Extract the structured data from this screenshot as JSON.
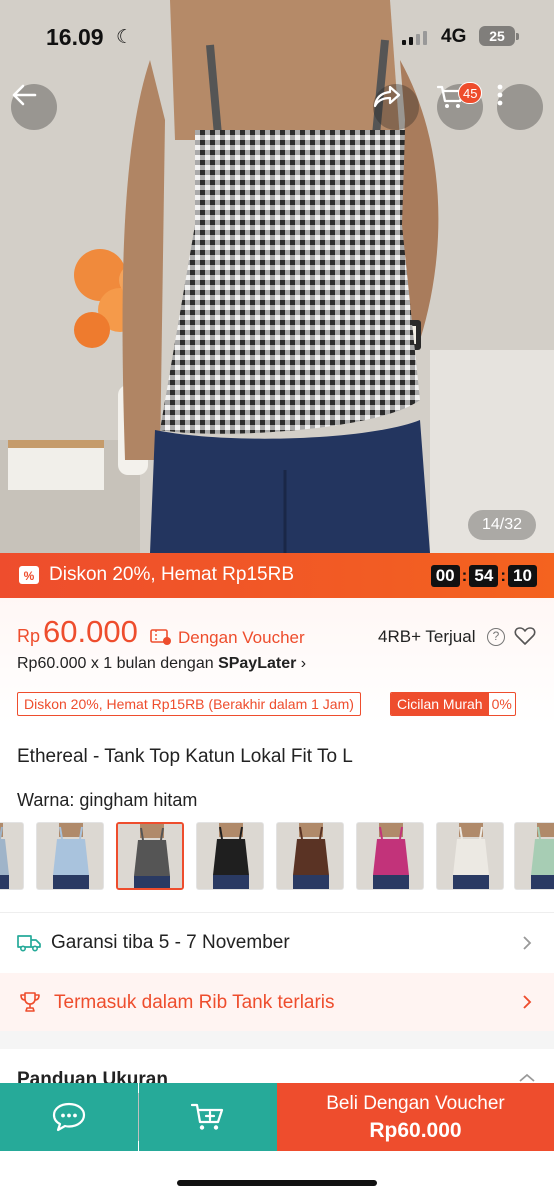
{
  "status_bar": {
    "time": "16.09",
    "network": "4G",
    "battery": "25"
  },
  "product_image": {
    "counter": "14/32"
  },
  "header": {
    "cart_count": "45"
  },
  "flash_sale": {
    "text": "Diskon 20%, Hemat Rp15RB",
    "timer": {
      "hours": "00",
      "minutes": "54",
      "seconds": "10"
    }
  },
  "price": {
    "currency": "Rp",
    "amount": "60.000",
    "voucher_label": "Dengan Voucher",
    "sold": "4RB+ Terjual",
    "paylater_prefix": "Rp60.000 x 1 bulan dengan ",
    "paylater_brand": "SPayLater",
    "paylater_arrow": "›",
    "tags": {
      "discount": "Diskon 20%, Hemat Rp15RB (Berakhir dalam 1 Jam)",
      "installment_label": "Cicilan Murah",
      "installment_value": "0%"
    }
  },
  "product": {
    "title": "Ethereal - Tank Top Katun Lokal Fit To L",
    "variant_key": "Warna:",
    "variant_value": " gingham hitam",
    "variants": [
      {
        "name": "variant-1",
        "color": "#9fb4c9",
        "selected": false
      },
      {
        "name": "variant-2",
        "color": "#a9c3dd",
        "selected": false
      },
      {
        "name": "variant-3",
        "color": "#555555",
        "selected": true
      },
      {
        "name": "variant-4",
        "color": "#1f1f1f",
        "selected": false
      },
      {
        "name": "variant-5",
        "color": "#5a3324",
        "selected": false
      },
      {
        "name": "variant-6",
        "color": "#c2337a",
        "selected": false
      },
      {
        "name": "variant-7",
        "color": "#ece9e3",
        "selected": false
      },
      {
        "name": "variant-8",
        "color": "#a7cdb4",
        "selected": false
      }
    ]
  },
  "info_rows": {
    "delivery": "Garansi tiba 5 - 7 November",
    "bestseller": "Termasuk dalam Rib Tank terlaris",
    "size_guide": "Panduan Ukuran"
  },
  "bottom_bar": {
    "buy_label": "Beli Dengan Voucher",
    "buy_price": "Rp60.000"
  },
  "colors": {
    "brand": "#ee4d2d",
    "teal": "#26aa99"
  },
  "icons": [
    "back-arrow-icon",
    "share-icon",
    "cart-icon",
    "more-icon",
    "flash-ticket-icon",
    "voucher-icon",
    "help-icon",
    "heart-icon",
    "truck-icon",
    "trophy-icon",
    "chevron-right-icon",
    "chat-icon",
    "add-to-cart-icon",
    "moon-icon",
    "signal-icon",
    "battery-icon"
  ]
}
